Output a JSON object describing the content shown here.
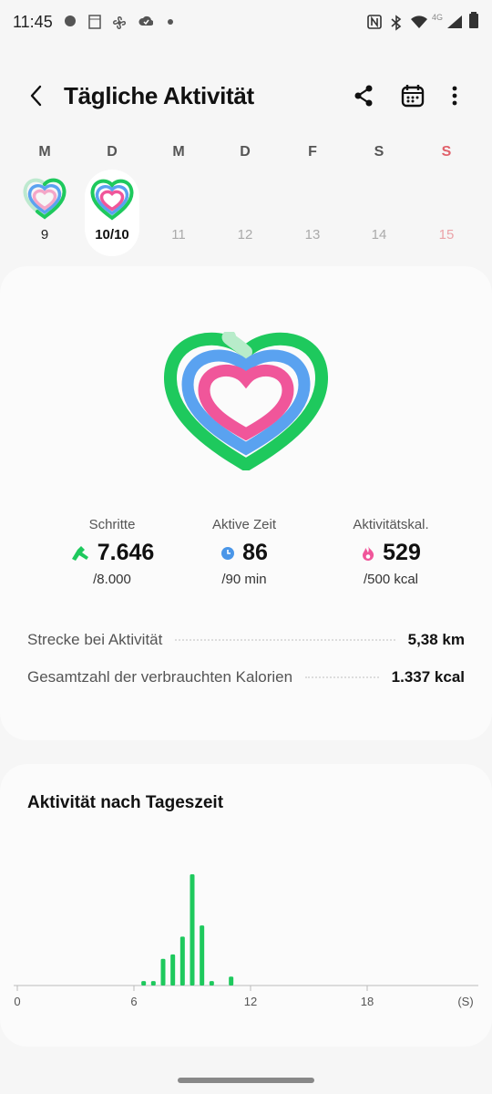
{
  "status_bar": {
    "time": "11:45",
    "network": "4G"
  },
  "header": {
    "title": "Tägliche Aktivität",
    "icons": [
      "back-arrow-icon",
      "share-icon",
      "calendar-icon",
      "more-vert-icon"
    ]
  },
  "week": {
    "days": [
      {
        "label": "M",
        "number": "9",
        "has_ring": true,
        "selected": false,
        "weekend": false
      },
      {
        "label": "D",
        "number": "10/10",
        "has_ring": true,
        "selected": true,
        "weekend": false
      },
      {
        "label": "M",
        "number": "11",
        "has_ring": false,
        "selected": false,
        "weekend": false
      },
      {
        "label": "D",
        "number": "12",
        "has_ring": false,
        "selected": false,
        "weekend": false
      },
      {
        "label": "F",
        "number": "13",
        "has_ring": false,
        "selected": false,
        "weekend": false
      },
      {
        "label": "S",
        "number": "14",
        "has_ring": false,
        "selected": false,
        "weekend": false
      },
      {
        "label": "S",
        "number": "15",
        "has_ring": false,
        "selected": false,
        "weekend": true
      }
    ]
  },
  "rings": {
    "steps_fraction": 0.96,
    "active_time_fraction": 0.96,
    "calories_fraction": 1.0,
    "colors": {
      "steps": "#1ec95d",
      "active_time": "#5aa2f0",
      "calories": "#f0569a"
    }
  },
  "stats": {
    "steps": {
      "label": "Schritte",
      "value": "7.646",
      "goal": "/8.000",
      "icon": "running-shoe-icon",
      "color": "#1ec95d"
    },
    "active_time": {
      "label": "Aktive Zeit",
      "value": "86",
      "goal": "/90 min",
      "icon": "clock-icon",
      "color": "#4a96e8"
    },
    "calories": {
      "label": "Aktivitätskal.",
      "value": "529",
      "goal": "/500 kcal",
      "icon": "flame-icon",
      "color": "#f0569a"
    }
  },
  "details": {
    "distance": {
      "label": "Strecke bei Aktivität",
      "value": "5,38 km"
    },
    "total_calories": {
      "label": "Gesamtzahl der verbrauchten Kalorien",
      "value": "1.337 kcal"
    }
  },
  "chart_data": {
    "type": "bar",
    "title": "Aktivität nach Tageszeit",
    "xlabel": "",
    "ylabel": "",
    "x_ticks": [
      "0",
      "6",
      "12",
      "18"
    ],
    "x_unit": "(S)",
    "xlim": [
      0,
      24
    ],
    "ylim": [
      0,
      1
    ],
    "x": [
      6.5,
      7.0,
      7.5,
      8.0,
      8.5,
      9.0,
      9.5,
      10.0,
      11.0
    ],
    "values": [
      0.04,
      0.04,
      0.24,
      0.28,
      0.44,
      1.0,
      0.54,
      0.04,
      0.08
    ],
    "color": "#1ec95d"
  }
}
